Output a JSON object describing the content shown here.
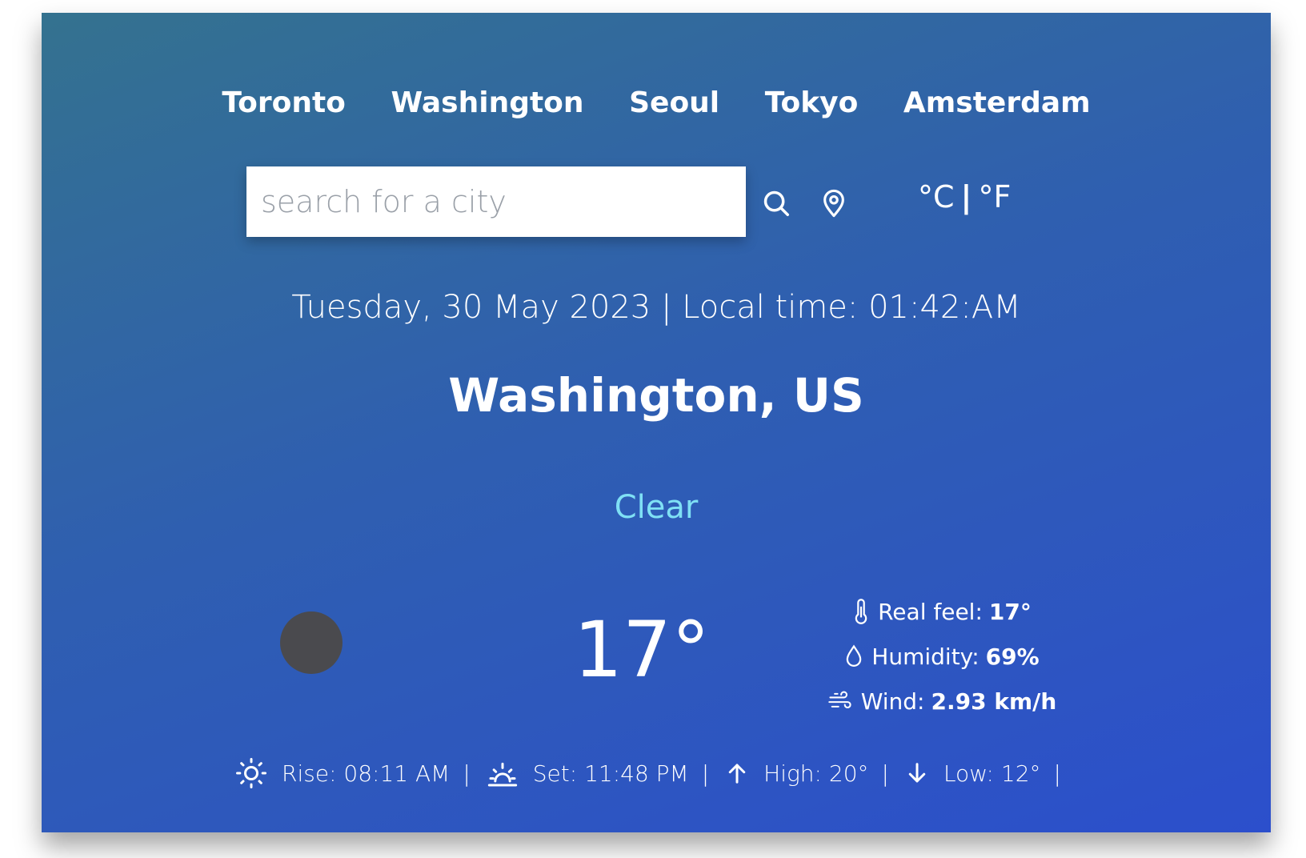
{
  "top_cities": [
    "Toronto",
    "Washington",
    "Seoul",
    "Tokyo",
    "Amsterdam"
  ],
  "search": {
    "placeholder": "search for a city",
    "value": ""
  },
  "units": {
    "celsius_label": "°C",
    "separator": "|",
    "fahrenheit_label": "°F"
  },
  "date_line": "Tuesday, 30 May 2023 | Local time: 01:42:AM",
  "location": "Washington, US",
  "condition": "Clear",
  "temperature": "17°",
  "details": {
    "real_feel_label": "Real feel:",
    "real_feel_value": "17°",
    "humidity_label": "Humidity:",
    "humidity_value": "69%",
    "wind_label": "Wind:",
    "wind_value": "2.93 km/h"
  },
  "bottom": {
    "rise": "Rise: 08:11 AM",
    "set": "Set: 11:48 PM",
    "high": "High: 20°",
    "low": "Low: 12°",
    "separator": "|"
  },
  "colors": {
    "gradient_start": "#34728f",
    "gradient_end": "#2c4fcc",
    "condition_text": "#7fe0f5",
    "weather_icon_placeholder": "#4a4a4e"
  },
  "icons": {
    "search": "search-icon",
    "location": "location-pin-icon",
    "thermometer": "thermometer-icon",
    "humidity": "water-drop-icon",
    "wind": "wind-icon",
    "sunrise": "sun-icon",
    "sunset": "sunset-icon",
    "high": "arrow-up-icon",
    "low": "arrow-down-icon"
  }
}
